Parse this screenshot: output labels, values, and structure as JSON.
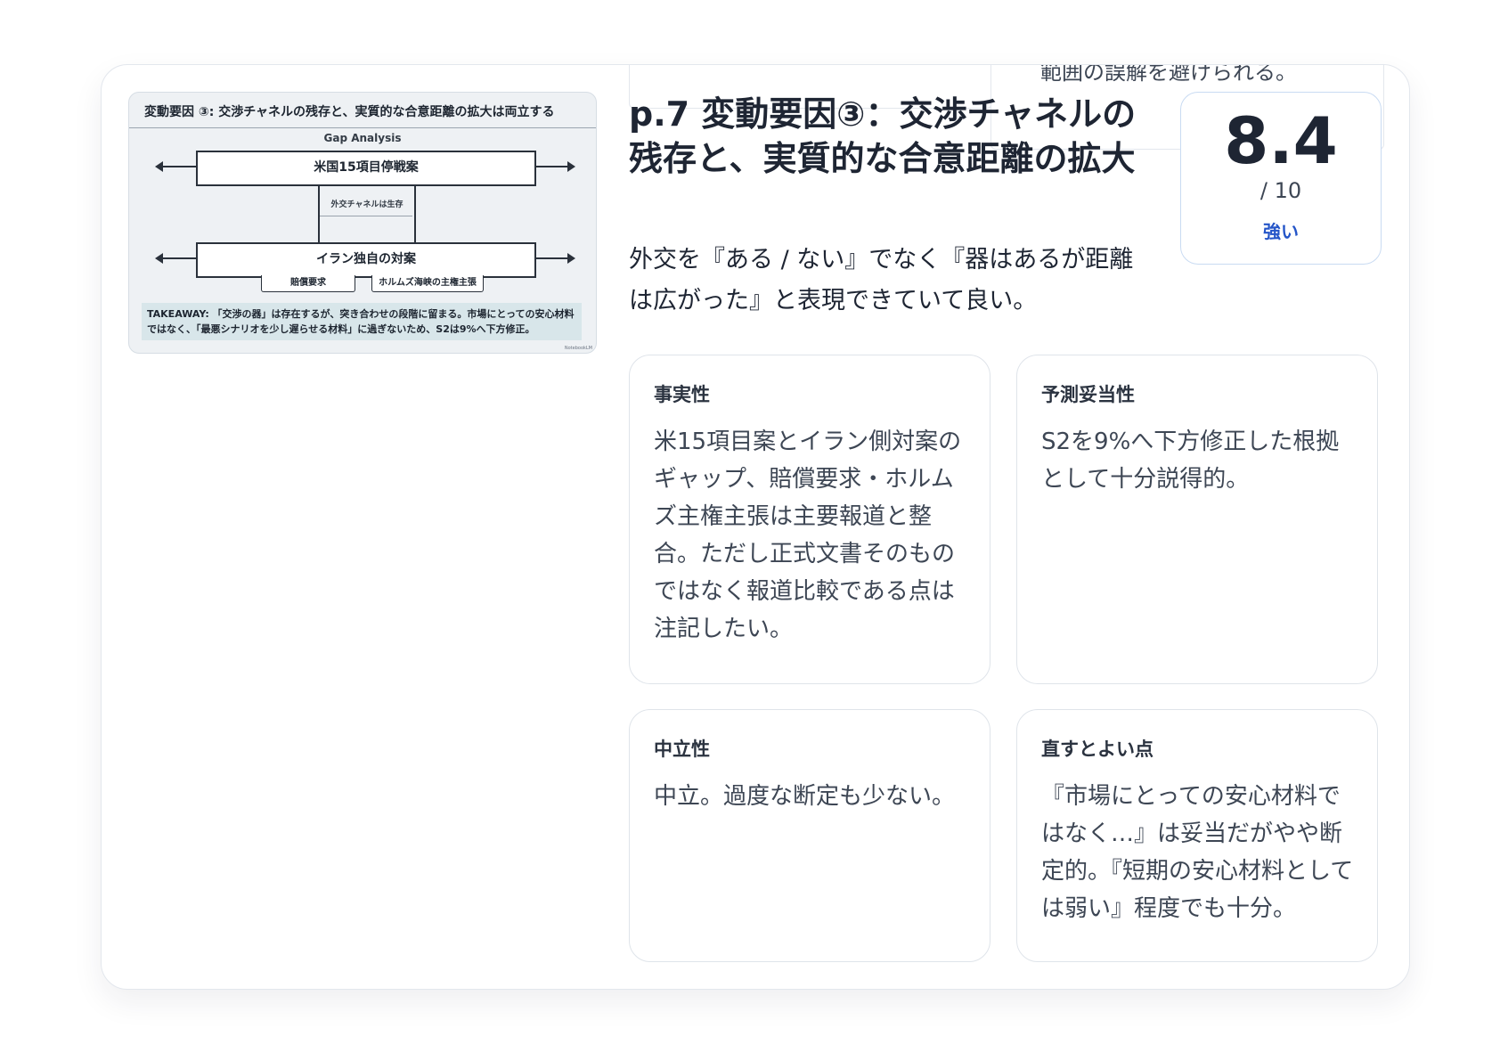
{
  "background": {
    "cut_text": "範囲の誤解を避けられる。"
  },
  "slide": {
    "title": "変動要因 ③: 交渉チャネルの残存と、実質的な合意距離の拡大は両立する",
    "subtitle": "Gap Analysis",
    "top_bar": "米国15項目停戦案",
    "link_label": "外交チャネルは生存",
    "bottom_bar": "イラン独自の対案",
    "tags": [
      "賠償要求",
      "ホルムズ海峡の主権主張"
    ],
    "takeaway": "TAKEAWAY: 「交渉の器」は存在するが、突き合わせの段階に留まる。市場にとっての安心材料ではなく、「最悪シナリオを少し遅らせる材料」に過ぎないため、S2は9%へ下方修正。",
    "credit": "NotebookLM"
  },
  "review": {
    "title": "p.7 変動要因③：交渉チャネルの残存と、実質的な合意距離の拡大",
    "summary": "外交を『ある / ない』でなく『器はあるが距離は広がった』と表現できていて良い。",
    "score": "8.4",
    "score_max": "/ 10",
    "score_label": "強い",
    "accent_color": "#2455c8"
  },
  "panels": [
    {
      "heading": "事実性",
      "body": "米15項目案とイラン側対案のギャップ、賠償要求・ホルムズ主権主張は主要報道と整合。ただし正式文書そのものではなく報道比較である点は注記したい。"
    },
    {
      "heading": "予測妥当性",
      "body": "S2を9%へ下方修正した根拠として十分説得的。"
    },
    {
      "heading": "中立性",
      "body": "中立。過度な断定も少ない。"
    },
    {
      "heading": "直すとよい点",
      "body": "『市場にとっての安心材料ではなく…』は妥当だがやや断定的。『短期の安心材料としては弱い』程度でも十分。"
    }
  ]
}
